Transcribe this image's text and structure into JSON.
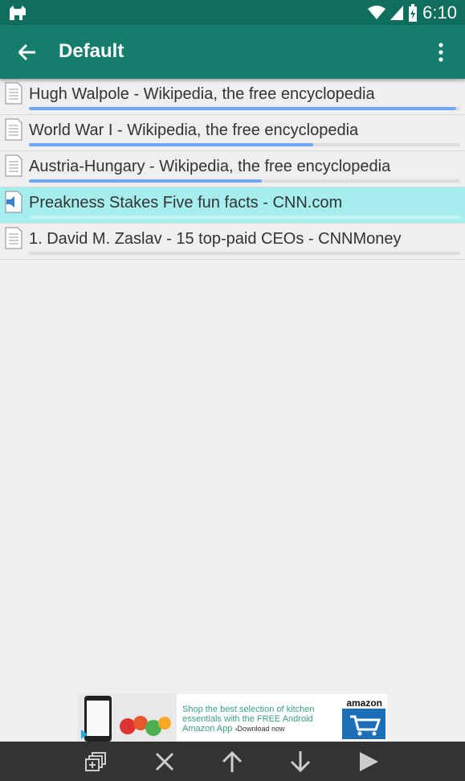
{
  "status": {
    "time": "6:10"
  },
  "toolbar": {
    "title": "Default"
  },
  "items": [
    {
      "label": "Hugh Walpole - Wikipedia, the free encyclopedia",
      "progress": 0.99,
      "active": false
    },
    {
      "label": "World War I - Wikipedia, the free encyclopedia",
      "progress": 0.66,
      "active": false
    },
    {
      "label": "Austria-Hungary - Wikipedia, the free encyclopedia",
      "progress": 0.54,
      "active": false
    },
    {
      "label": "Preakness Stakes Five fun facts - CNN.com",
      "progress": 0.0,
      "active": true
    },
    {
      "label": "1. David M. Zaslav - 15 top-paid CEOs - CNNMoney",
      "progress": 0.0,
      "active": false
    }
  ],
  "ad": {
    "line1": "Shop the best selection of kitchen",
    "line2": "essentials with the FREE Android",
    "line3": "Amazon App",
    "download": "›Download now",
    "brand": "amazon"
  },
  "colors": {
    "statusbar": "#0f6e5c",
    "toolbar": "#157d6b",
    "active_row": "#a6eeee",
    "progress": "#6fa8ff"
  },
  "bottom": {
    "icons": [
      "add-playlist-icon",
      "close-icon",
      "arrow-up-icon",
      "arrow-down-icon",
      "play-icon"
    ]
  }
}
